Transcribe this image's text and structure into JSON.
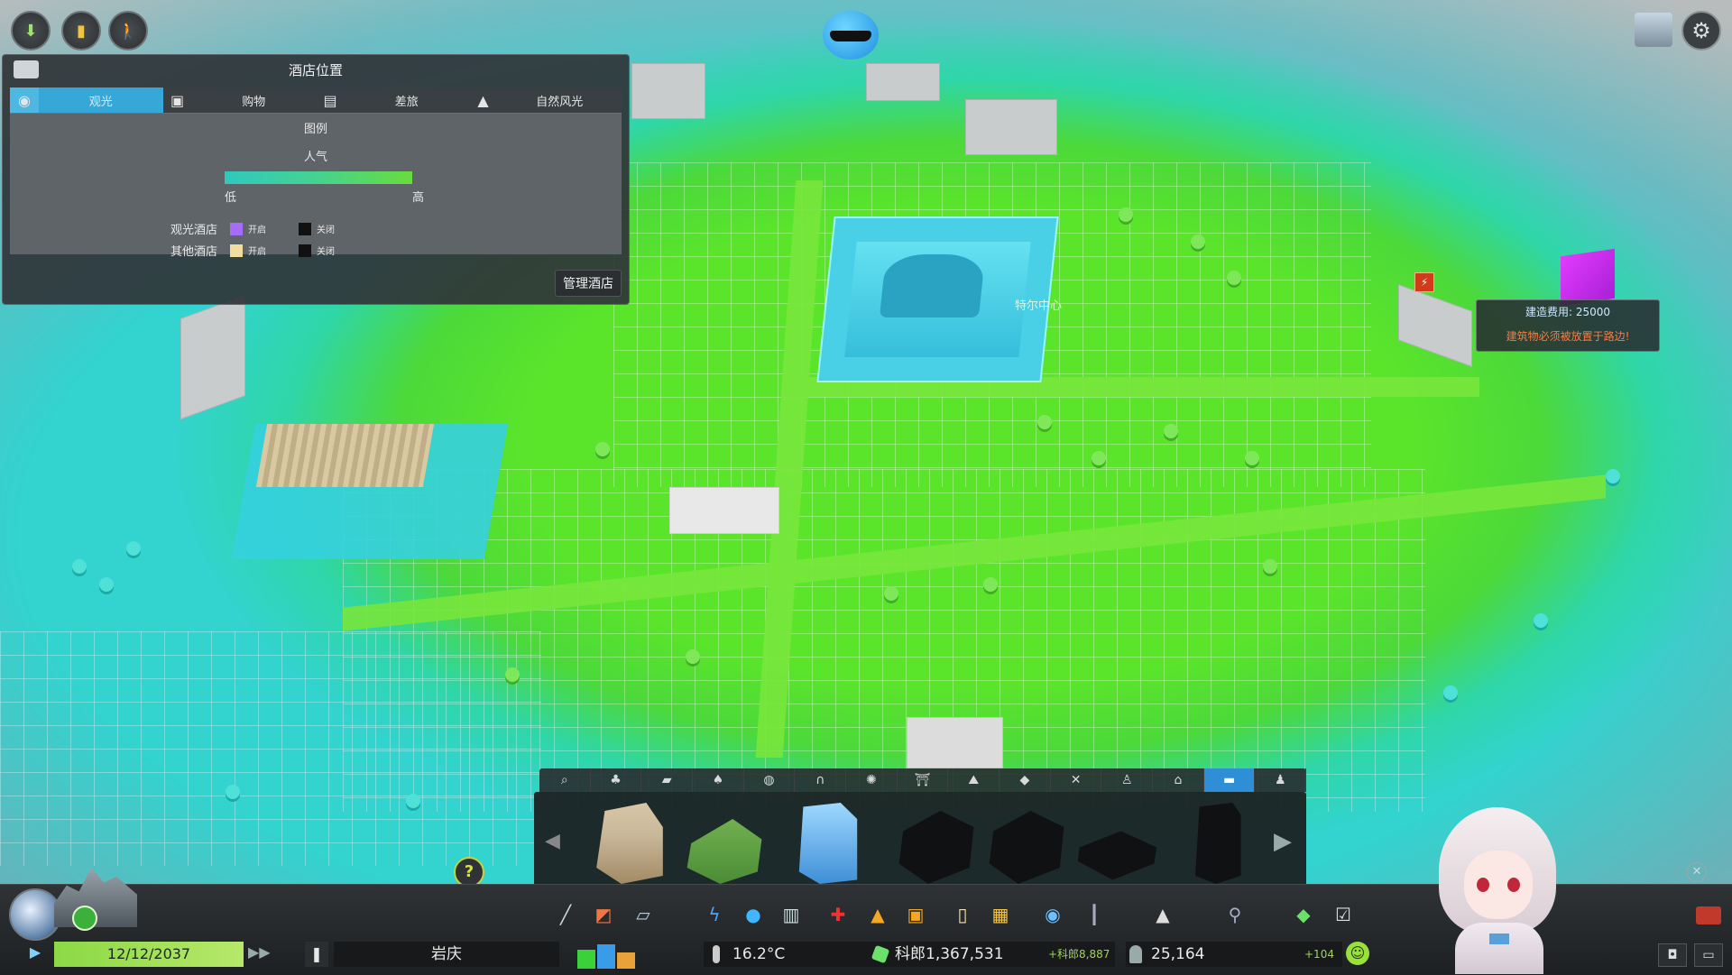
{
  "panel": {
    "title": "酒店位置",
    "tabs": [
      {
        "label": "观光",
        "icon": "camera-icon",
        "active": true
      },
      {
        "label": "购物",
        "icon": "shopping-bag-icon",
        "active": false
      },
      {
        "label": "差旅",
        "icon": "briefcase-icon",
        "active": false
      },
      {
        "label": "自然风光",
        "icon": "mountain-icon",
        "active": false
      }
    ],
    "legend_title": "图例",
    "popularity_label": "人气",
    "low": "低",
    "high": "高",
    "rows": [
      {
        "name": "观光酒店",
        "on": "开启",
        "off": "关闭",
        "on_color": "#a66cff",
        "off_color": "#111111"
      },
      {
        "name": "其他酒店",
        "on": "开启",
        "off": "关闭",
        "on_color": "#f2dca0",
        "off_color": "#111111"
      }
    ],
    "manage_button": "管理酒店"
  },
  "map": {
    "center_label": "特尔中心"
  },
  "tooltip": {
    "cost": "建造费用: 25000",
    "warning": "建筑物必须被放置于路边!"
  },
  "build_tabs": [
    {
      "icon": "search-icon"
    },
    {
      "icon": "tree-icon"
    },
    {
      "icon": "road-icon"
    },
    {
      "icon": "park-icon"
    },
    {
      "icon": "plaza-icon"
    },
    {
      "icon": "arch-icon"
    },
    {
      "icon": "ferris-wheel-icon"
    },
    {
      "icon": "gate-icon"
    },
    {
      "icon": "terrain-icon"
    },
    {
      "icon": "cube-icon"
    },
    {
      "icon": "tools-icon"
    },
    {
      "icon": "pedestrian-icon"
    },
    {
      "icon": "shop-icon"
    },
    {
      "icon": "hotel-icon",
      "active": true
    },
    {
      "icon": "person-icon"
    }
  ],
  "bottom": {
    "date": "12/12/2037",
    "city_name": "岩庆",
    "temperature": "16.2°C",
    "money": "科郎1,367,531",
    "money_delta": "+科郎8,887",
    "population": "25,164",
    "population_delta": "+104"
  },
  "colors": {
    "accent_blue": "#36a8d8",
    "map_green": "#5be52a",
    "map_cyan": "#33d3cf",
    "date_green": "#8bd945",
    "warning_orange": "#ff7a3d"
  }
}
